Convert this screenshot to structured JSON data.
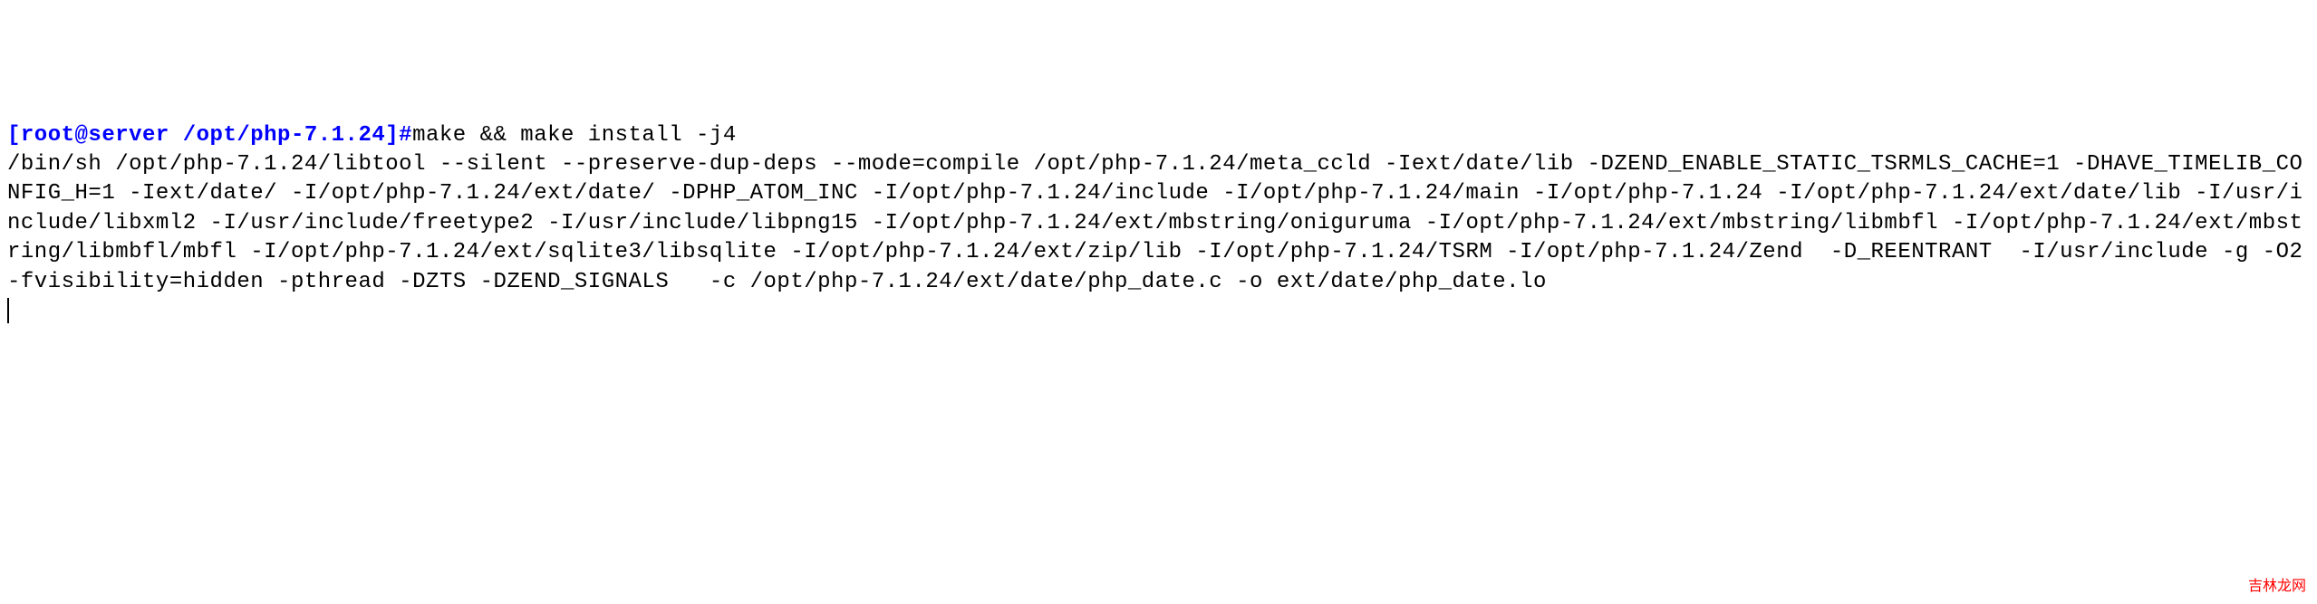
{
  "terminal": {
    "prompt": {
      "user_host": "[root@server",
      "path": " /opt/php-7.1.24]",
      "symbol": "#"
    },
    "command": "make && make install -j4",
    "output": "/bin/sh /opt/php-7.1.24/libtool --silent --preserve-dup-deps --mode=compile /opt/php-7.1.24/meta_ccld -Iext/date/lib -DZEND_ENABLE_STATIC_TSRMLS_CACHE=1 -DHAVE_TIMELIB_CONFIG_H=1 -Iext/date/ -I/opt/php-7.1.24/ext/date/ -DPHP_ATOM_INC -I/opt/php-7.1.24/include -I/opt/php-7.1.24/main -I/opt/php-7.1.24 -I/opt/php-7.1.24/ext/date/lib -I/usr/include/libxml2 -I/usr/include/freetype2 -I/usr/include/libpng15 -I/opt/php-7.1.24/ext/mbstring/oniguruma -I/opt/php-7.1.24/ext/mbstring/libmbfl -I/opt/php-7.1.24/ext/mbstring/libmbfl/mbfl -I/opt/php-7.1.24/ext/sqlite3/libsqlite -I/opt/php-7.1.24/ext/zip/lib -I/opt/php-7.1.24/TSRM -I/opt/php-7.1.24/Zend  -D_REENTRANT  -I/usr/include -g -O2 -fvisibility=hidden -pthread -DZTS -DZEND_SIGNALS   -c /opt/php-7.1.24/ext/date/php_date.c -o ext/date/php_date.lo"
  },
  "watermark": "吉林龙网"
}
